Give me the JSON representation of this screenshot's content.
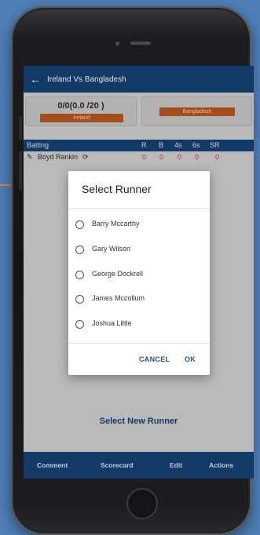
{
  "app": {
    "title": "Ireland Vs Bangladesh"
  },
  "teams": {
    "left": {
      "score": "0/0(0.0 /20 )",
      "name": "Ireland"
    },
    "right": {
      "name": "Bangladesh"
    }
  },
  "batting_table": {
    "headers": [
      "Batting",
      "R",
      "B",
      "4s",
      "6s",
      "SR"
    ],
    "row": {
      "player": "Boyd Rankin",
      "values": [
        "0",
        "0",
        "0",
        "0",
        "0"
      ]
    }
  },
  "dialog": {
    "title": "Select Runner",
    "runners": [
      "Barry Mccarthy",
      "Gary Wilson",
      "George Dockrell",
      "James Mccollum",
      "Joshua Little"
    ],
    "cancel_label": "CANCEL",
    "ok_label": "OK"
  },
  "footer": {
    "select_new_runner": "Select New Runner",
    "nav": [
      "Comment",
      "Scorecard",
      "Edit",
      "Actions"
    ]
  },
  "colors": {
    "primary": "#143f73",
    "accent": "#b9561d",
    "background": "#4f7fb8"
  }
}
